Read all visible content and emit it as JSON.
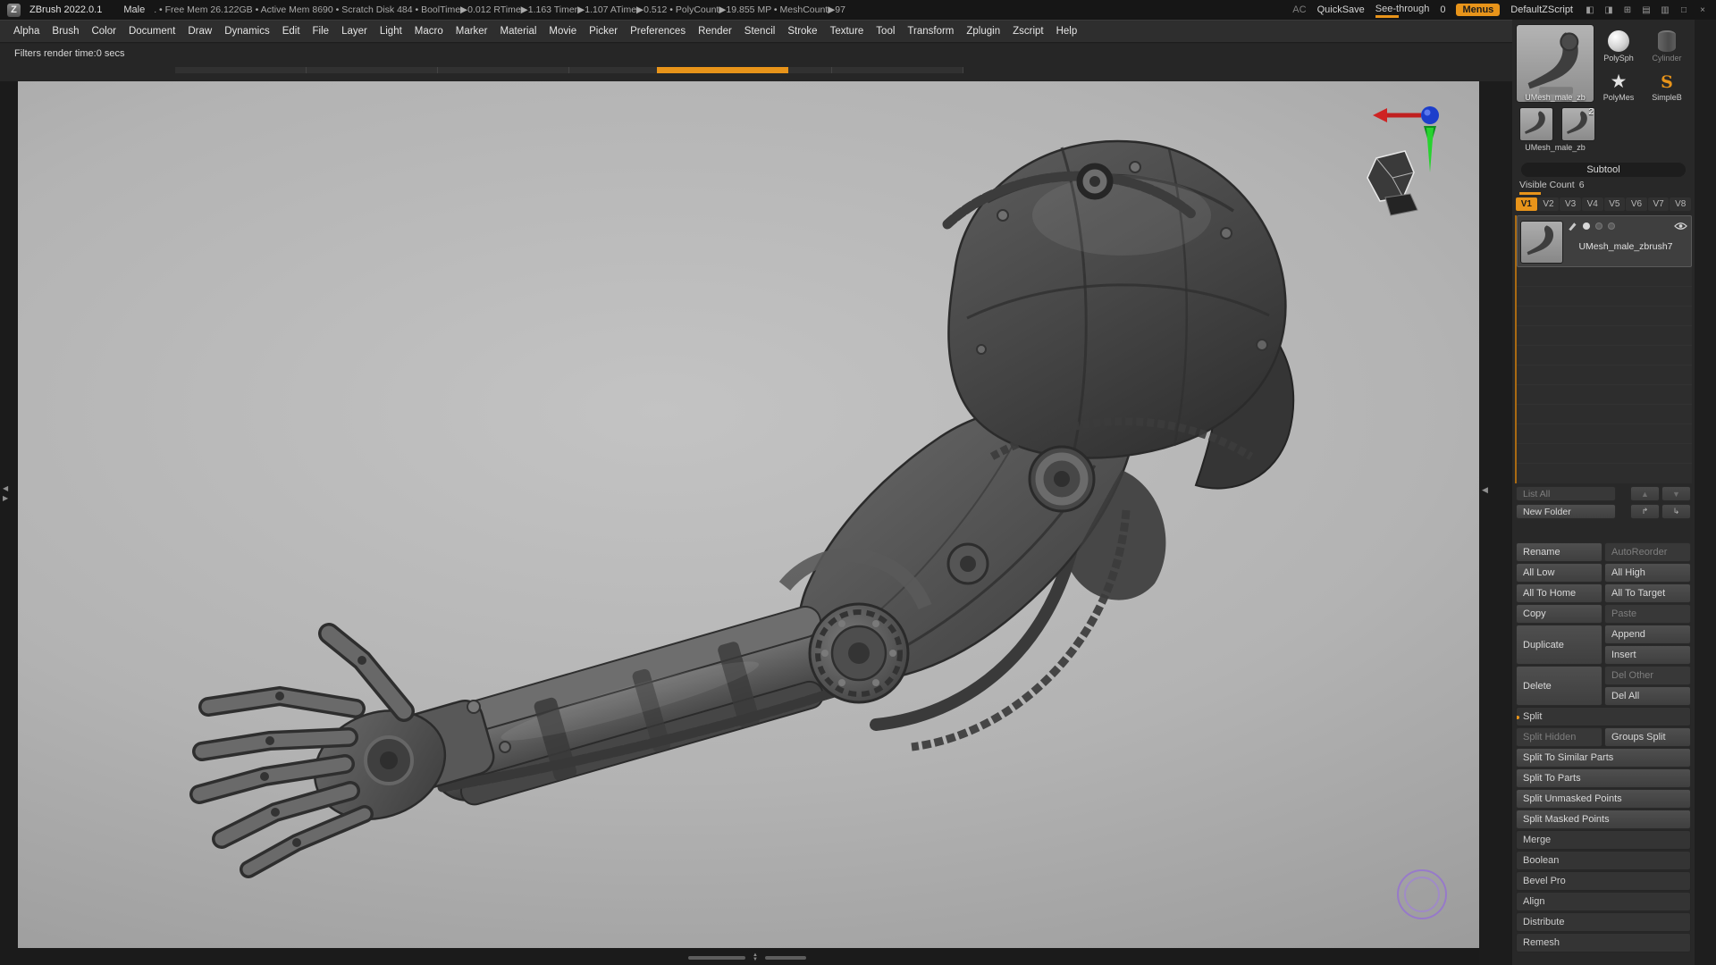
{
  "titlebar": {
    "logo_glyph": "Z",
    "app": "ZBrush 2022.0.1",
    "doc": "Male",
    "stats": ". • Free Mem 26.122GB • Active Mem 8690 • Scratch Disk 484 • BoolTime▶0.012 RTime▶1.163 Timer▶1.107 ATime▶0.512 • PolyCount▶19.855 MP • MeshCount▶97",
    "ac": "AC",
    "quicksave": "QuickSave",
    "see_through": "See-through",
    "see_through_value": "0",
    "menus": "Menus",
    "zscript": "DefaultZScript",
    "icons": [
      {
        "name": "collapse-left-tray-icon",
        "glyph": "◧"
      },
      {
        "name": "collapse-right-tray-icon",
        "glyph": "◨"
      },
      {
        "name": "add-palette-icon",
        "glyph": "⊞"
      },
      {
        "name": "layout-grid-icon",
        "glyph": "▤"
      },
      {
        "name": "layout-columns-icon",
        "glyph": "▥"
      },
      {
        "name": "window-maximize-icon",
        "glyph": "□"
      },
      {
        "name": "window-close-icon",
        "glyph": "×"
      }
    ]
  },
  "menubar": {
    "items": [
      "Alpha",
      "Brush",
      "Color",
      "Document",
      "Draw",
      "Dynamics",
      "Edit",
      "File",
      "Layer",
      "Light",
      "Macro",
      "Marker",
      "Material",
      "Movie",
      "Picker",
      "Preferences",
      "Render",
      "Stencil",
      "Stroke",
      "Texture",
      "Tool",
      "Transform",
      "Zplugin",
      "Zscript",
      "Help"
    ]
  },
  "statusline": {
    "filters": "Filters render time:0 secs"
  },
  "tool_shelf": {
    "current_tool_label": "UMesh_male_zb",
    "quick_items": [
      {
        "label": "PolySph"
      },
      {
        "label": "Cylinder"
      },
      {
        "label": "PolyMes"
      },
      {
        "label": "SimpleB"
      }
    ],
    "recent_label": "UMesh_male_zb",
    "recent_badge": "2"
  },
  "subtool": {
    "title": "Subtool",
    "visible_count_label": "Visible Count",
    "visible_count_value": "6",
    "tabs": [
      "V1",
      "V2",
      "V3",
      "V4",
      "V5",
      "V6",
      "V7",
      "V8"
    ],
    "active_tab": "V1",
    "item_name": "UMesh_male_zbrush7",
    "list_all": "List All",
    "new_folder": "New Folder",
    "icons": {
      "up": "▲",
      "down": "▼",
      "folder_up": "↱",
      "folder_down": "↳"
    },
    "buttons": {
      "rename": "Rename",
      "autoreorder": "AutoReorder",
      "all_low": "All Low",
      "all_high": "All High",
      "all_to_home": "All To Home",
      "all_to_target": "All To Target",
      "copy": "Copy",
      "paste": "Paste",
      "duplicate": "Duplicate",
      "append": "Append",
      "insert": "Insert",
      "delete": "Delete",
      "del_other": "Del Other",
      "del_all": "Del All",
      "split": "Split",
      "split_hidden": "Split Hidden",
      "groups_split": "Groups Split",
      "split_similar": "Split To Similar Parts",
      "split_parts": "Split To Parts",
      "split_unmasked": "Split Unmasked Points",
      "split_masked": "Split Masked Points",
      "merge": "Merge",
      "boolean": "Boolean",
      "bevel_pro": "Bevel Pro",
      "align": "Align",
      "distribute": "Distribute",
      "remesh": "Remesh"
    }
  },
  "colors": {
    "accent": "#e8941a",
    "brush_cursor": "#8f6bd4",
    "canvas": "#bdbdbd"
  }
}
